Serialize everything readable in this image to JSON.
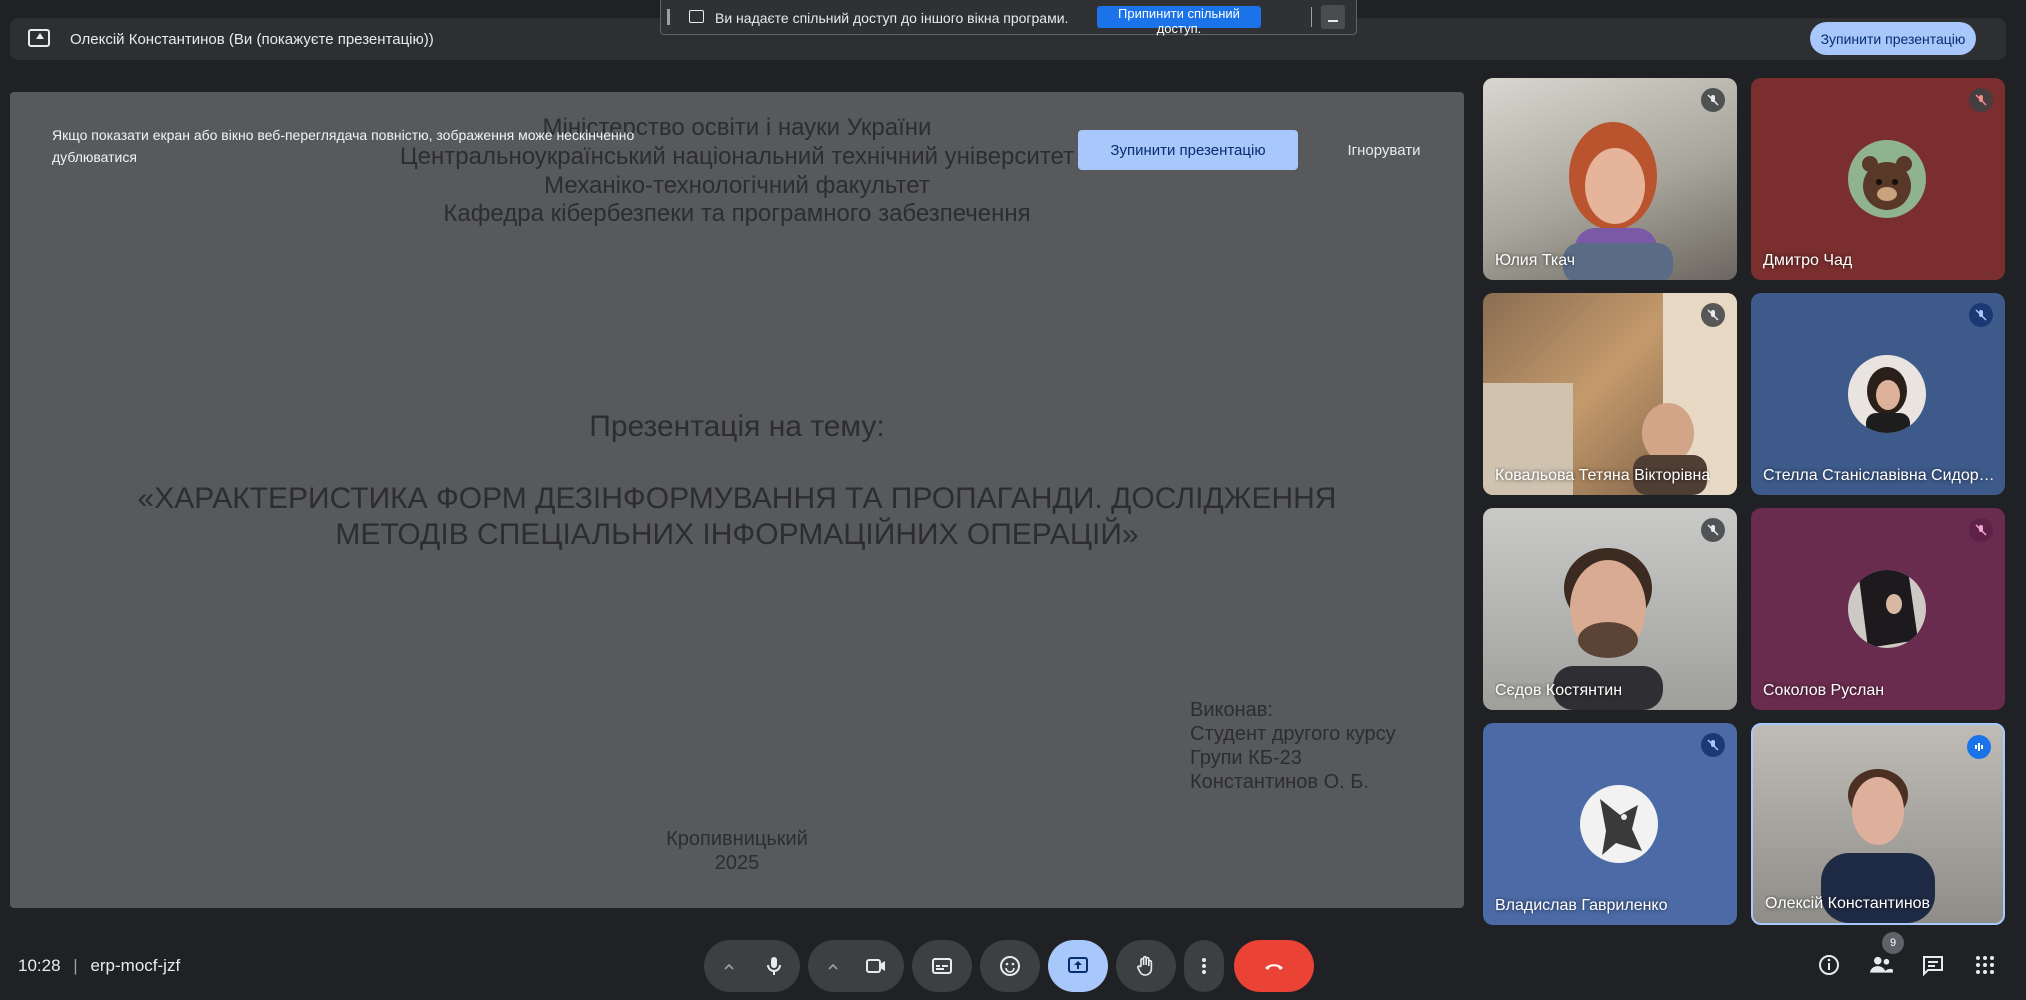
{
  "presenter_bar": {
    "title": "Олексій Константинов (Ви (покажуєте презентацію))",
    "stop_label": "Зупинити презентацію"
  },
  "chrome_share_bar": {
    "message": "Ви надаєте спільний доступ до іншого вікна програми.",
    "stop_label": "Припинити спільний доступ."
  },
  "warning": {
    "text": "Якщо показати екран або вікно веб-переглядача повністю, зображення може нескінченно дублюватися",
    "stop_label": "Зупинити презентацію",
    "ignore_label": "Ігнорувати"
  },
  "slide": {
    "header_lines": [
      "Міністерство освіти і науки України",
      "Центральноукраїнський національний технічний університет",
      "Механіко-технологічний факультет",
      "Кафедра кібербезпеки та програмного забезпечення"
    ],
    "topic_label": "Презентація на тему:",
    "title_lines": [
      "«ХАРАКТЕРИСТИКА ФОРМ ДЕЗІНФОРМУВАННЯ ТА ПРОПАГАНДИ. ДОСЛІДЖЕННЯ",
      "МЕТОДІВ СПЕЦІАЛЬНИХ ІНФОРМАЦІЙНИХ ОПЕРАЦІЙ»"
    ],
    "author_lines": [
      "Виконав:",
      "Студент другого курсу",
      "Групи КБ-23",
      "Константинов О. Б."
    ],
    "city": "Кропивницький",
    "year": "2025"
  },
  "participants": [
    {
      "name": "Юлия Ткач",
      "mic": "muted"
    },
    {
      "name": "Дмитро Чад",
      "mic": "muted"
    },
    {
      "name": "Ковальова Тетяна Вікторівна",
      "mic": "muted"
    },
    {
      "name": "Стелла Станіславівна Сидоренко",
      "mic": "muted"
    },
    {
      "name": "Сєдов Костянтин",
      "mic": "muted"
    },
    {
      "name": "Соколов Руслан",
      "mic": "muted"
    },
    {
      "name": "Владислав Гавриленко",
      "mic": "muted"
    },
    {
      "name": "Олексій Константинов",
      "mic": "speaking"
    }
  ],
  "bottom_bar": {
    "time": "10:28",
    "separator": "|",
    "meeting_code": "erp-mocf-jzf",
    "people_count": "9"
  },
  "colors": {
    "accent_light_blue": "#a8c7fa",
    "hangup_red": "#ea4335",
    "chrome_blue": "#1a73e8"
  }
}
